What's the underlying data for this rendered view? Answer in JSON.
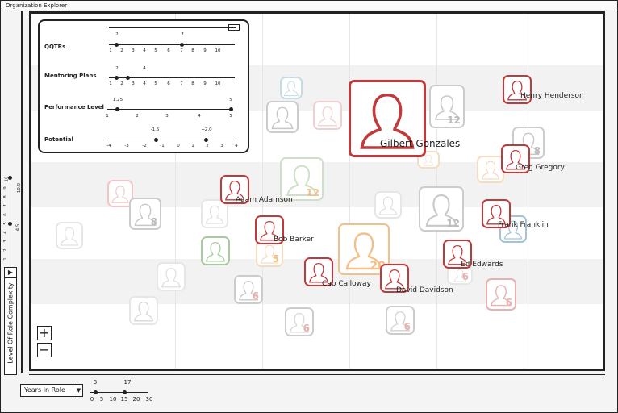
{
  "window": {
    "title": "Organization Explorer"
  },
  "filters": [
    {
      "label": "QQTRs",
      "ticks": [
        "1",
        "2",
        "3",
        "4",
        "5",
        "6",
        "7",
        "8",
        "9",
        "10"
      ],
      "values": [
        "2",
        "7"
      ],
      "range": [
        1,
        10
      ],
      "selected": [
        2,
        7
      ]
    },
    {
      "label": "Mentoring Plans",
      "ticks": [
        "1",
        "2",
        "3",
        "4",
        "5",
        "6",
        "7",
        "8",
        "9",
        "10"
      ],
      "values": [
        "2",
        "4"
      ],
      "range": [
        1,
        10
      ],
      "selected": [
        2,
        4
      ]
    },
    {
      "label": "Performance Level",
      "ticks": [
        "1",
        "2",
        "3",
        "4",
        "5"
      ],
      "values": [
        "1.25",
        "5"
      ],
      "range": [
        1,
        5
      ],
      "selected": [
        1.25,
        5
      ]
    },
    {
      "label": "Potential",
      "ticks": [
        "-4",
        "-3",
        "-2",
        "-1",
        "0",
        "1",
        "2",
        "3",
        "4"
      ],
      "values": [
        "-1.5",
        "+2.0"
      ],
      "range": [
        -4,
        4
      ],
      "selected": [
        -1.5,
        2.0
      ]
    }
  ],
  "y_axis": {
    "label": "Level Of Role Complexity",
    "ticks": [
      "1",
      "2",
      "3",
      "4",
      "5",
      "6",
      "7",
      "8",
      "9",
      "10"
    ],
    "values": [
      "4.5",
      "10.0"
    ],
    "range": [
      1,
      10
    ],
    "selected": [
      4.5,
      10.0
    ]
  },
  "x_axis": {
    "label": "Years In Role",
    "ticks": [
      "0",
      "5",
      "10",
      "15",
      "20",
      "30"
    ],
    "values": [
      "3",
      "17"
    ],
    "selected": [
      3,
      17
    ]
  },
  "zoom": {
    "in": "+",
    "out": "−"
  },
  "colors": {
    "highlight": "#c0393b",
    "faded": "#cccccc",
    "orange": "#f2c089",
    "green": "#a9c9a0",
    "blue": "#9fc3dc",
    "pink": "#e8b0ae"
  },
  "people": [
    {
      "name": "Gilbert Gonzales",
      "selected": true
    },
    {
      "name": "Henry Henderson"
    },
    {
      "name": "Greg Gregory"
    },
    {
      "name": "Adam Adamson"
    },
    {
      "name": "Frank Franklin"
    },
    {
      "name": "Bob Barker"
    },
    {
      "name": "Ed Edwards"
    },
    {
      "name": "Cab Calloway"
    },
    {
      "name": "David Davidson"
    }
  ],
  "group_counts": [
    "12",
    "12",
    "12",
    "8",
    "8",
    "20",
    "5",
    "6",
    "6",
    "6",
    "6",
    "6"
  ]
}
